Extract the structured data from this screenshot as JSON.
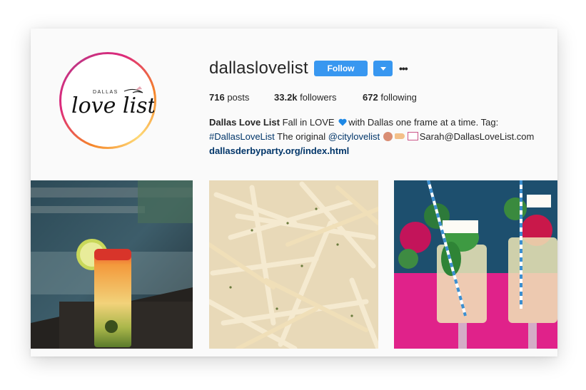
{
  "profile": {
    "username": "dallaslovelist",
    "avatar_logo": {
      "small": "DALLAS",
      "script": "love list"
    },
    "follow_label": "Follow",
    "more_icon": "more-horizontal-icon",
    "dropdown_icon": "chevron-down-icon"
  },
  "stats": [
    {
      "count": "716",
      "label": "posts"
    },
    {
      "count": "33.2k",
      "label": "followers"
    },
    {
      "count": "672",
      "label": "following"
    }
  ],
  "bio": {
    "name": "Dallas Love List",
    "text1": " Fall in LOVE ",
    "text2": "with Dallas one frame at a time. Tag:",
    "hashtag": "#DallasLoveList",
    "text3": " The original ",
    "mention": "@citylovelist",
    "email": "Sarah@DallasLoveList.com",
    "link": "dallasderbyparty.org/index.html"
  },
  "posts": [
    {
      "subject": "cocktail with lime"
    },
    {
      "subject": "french fries"
    },
    {
      "subject": "mint juleps cheers"
    }
  ],
  "colors": {
    "follow_blue": "#3897f0",
    "link_blue": "#003569",
    "card_bg": "#fafafa"
  }
}
